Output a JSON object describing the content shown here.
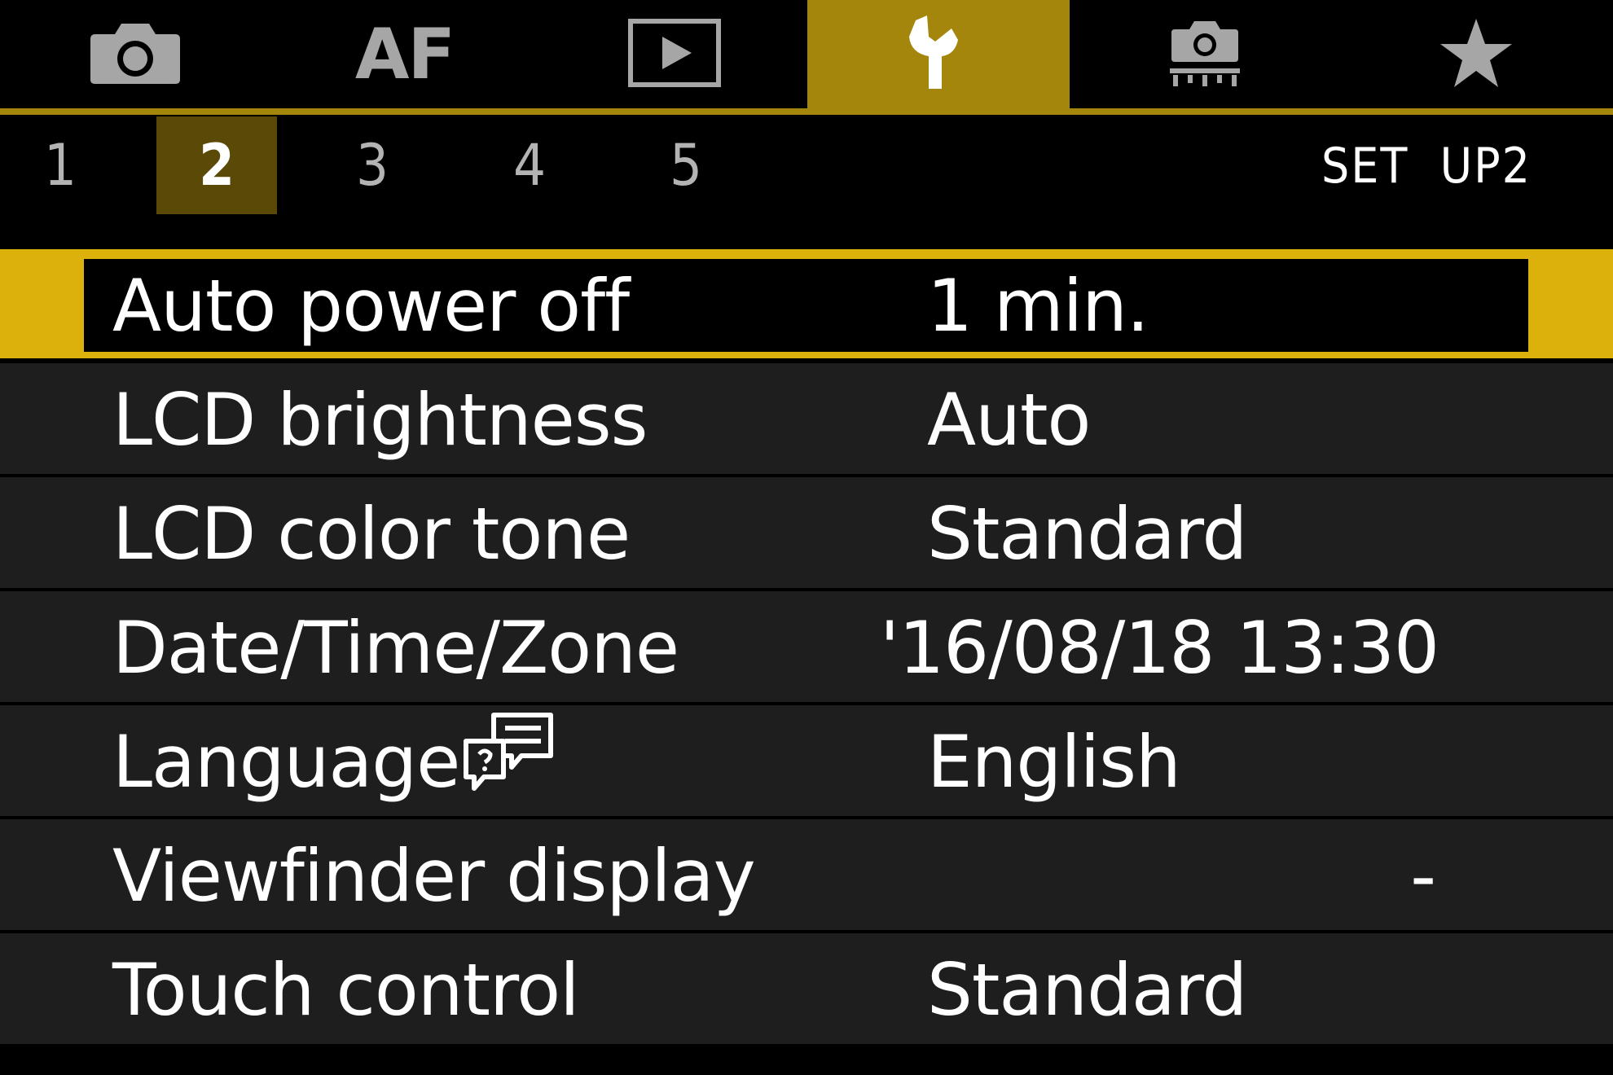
{
  "main_tabs": [
    {
      "id": "shooting",
      "icon": "camera-icon",
      "label": ""
    },
    {
      "id": "af",
      "icon": "",
      "label": "AF"
    },
    {
      "id": "playback",
      "icon": "play-icon",
      "label": ""
    },
    {
      "id": "setup",
      "icon": "wrench-icon",
      "label": "",
      "active": true
    },
    {
      "id": "custom",
      "icon": "custom-function-camera-icon",
      "label": ""
    },
    {
      "id": "my-menu",
      "icon": "star-icon",
      "label": ""
    }
  ],
  "sub_tabs": [
    "1",
    "2",
    "3",
    "4",
    "5"
  ],
  "active_sub_tab": "2",
  "page_label": "SET  UP2",
  "menu_items": [
    {
      "label": "Auto power off",
      "value": "1 min.",
      "selected": true
    },
    {
      "label": "LCD brightness",
      "value": "Auto"
    },
    {
      "label": "LCD color tone",
      "value": "Standard"
    },
    {
      "label": "Date/Time/Zone",
      "value": "'16/08/18 13:30"
    },
    {
      "label": "Language",
      "value": "English",
      "icon": "language-speech-icon"
    },
    {
      "label": "Viewfinder display",
      "value": "-"
    },
    {
      "label": "Touch control",
      "value": "Standard"
    }
  ],
  "colors": {
    "accent": "#a4860c",
    "selection": "#dcb10c",
    "sub_tab_active": "#5b4a07",
    "row_background": "#1e1e1e",
    "inactive_icon": "#a6a6a6"
  }
}
